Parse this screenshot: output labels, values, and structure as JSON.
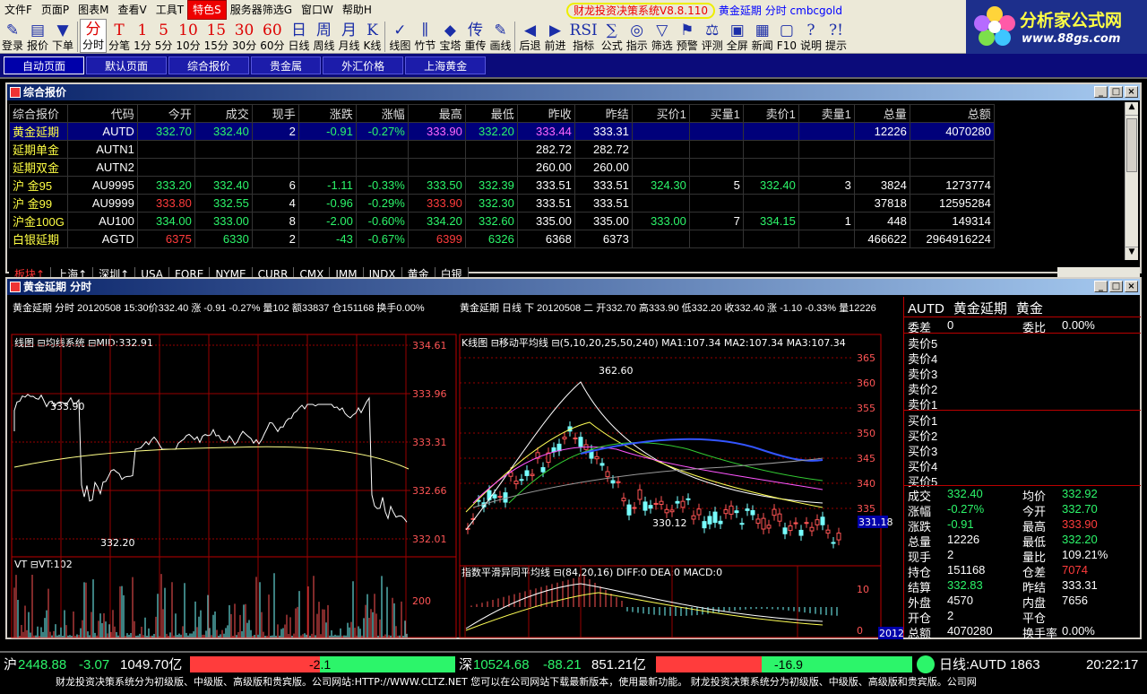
{
  "menu": {
    "items": [
      "文件F",
      "页面P",
      "图表M",
      "查看V",
      "工具T",
      "特色S",
      "服务器筛选G",
      "窗口W",
      "帮助H"
    ]
  },
  "app_title": {
    "name": "财龙投资决策系统V8.8.110",
    "symbol": "黄金延期",
    "view": "分时",
    "user": "cmbcgold"
  },
  "logo": {
    "cn": "分析家公式网",
    "url": "www.88gs.com"
  },
  "toolbar": [
    {
      "icon": "✎",
      "label": "登录"
    },
    {
      "icon": "▤",
      "label": "报价"
    },
    {
      "icon": "▼",
      "label": "下单"
    },
    {
      "icon": "分",
      "label": "分时"
    },
    {
      "icon": "T",
      "label": "分笔"
    },
    {
      "icon": "1",
      "label": "1分"
    },
    {
      "icon": "5",
      "label": "5分"
    },
    {
      "icon": "10",
      "label": "10分"
    },
    {
      "icon": "15",
      "label": "15分"
    },
    {
      "icon": "30",
      "label": "30分"
    },
    {
      "icon": "60",
      "label": "60分"
    },
    {
      "icon": "日",
      "label": "日线"
    },
    {
      "icon": "周",
      "label": "周线"
    },
    {
      "icon": "月",
      "label": "月线"
    },
    {
      "icon": "K",
      "label": "K线"
    },
    {
      "icon": "✓",
      "label": "线图"
    },
    {
      "icon": "∥",
      "label": "竹节"
    },
    {
      "icon": "◆",
      "label": "宝塔"
    },
    {
      "icon": "传",
      "label": "重传"
    },
    {
      "icon": "✎",
      "label": "画线"
    },
    {
      "icon": "◀",
      "label": "后退"
    },
    {
      "icon": "▶",
      "label": "前进"
    },
    {
      "icon": "RSI",
      "label": "指标"
    },
    {
      "icon": "∑",
      "label": "公式"
    },
    {
      "icon": "◎",
      "label": "指示"
    },
    {
      "icon": "▽",
      "label": "筛选"
    },
    {
      "icon": "⚑",
      "label": "预警"
    },
    {
      "icon": "⚖",
      "label": "评测"
    },
    {
      "icon": "▣",
      "label": "全屏"
    },
    {
      "icon": "▦",
      "label": "新闻"
    },
    {
      "icon": "▢",
      "label": "F10"
    },
    {
      "icon": "?",
      "label": "说明"
    },
    {
      "icon": "?!",
      "label": "提示"
    }
  ],
  "nav_tabs": [
    "自动页面",
    "默认页面",
    "综合报价",
    "贵金属",
    "外汇价格",
    "上海黄金"
  ],
  "quote_window": {
    "title": "综合报价",
    "columns": [
      "综合报价",
      "代码",
      "今开",
      "成交",
      "现手",
      "涨跌",
      "涨幅",
      "最高",
      "最低",
      "昨收",
      "昨结",
      "买价1",
      "买量1",
      "卖价1",
      "卖量1",
      "总量",
      "总额"
    ],
    "rows": [
      [
        "黄金延期",
        "AUTD",
        "332.70",
        "332.40",
        "2",
        "-0.91",
        "-0.27%",
        "333.90",
        "332.20",
        "333.44",
        "333.31",
        "",
        "",
        "",
        "",
        "12226",
        "4070280"
      ],
      [
        "延期单金",
        "AUTN1",
        "",
        "",
        "",
        "",
        "",
        "",
        "",
        "282.72",
        "282.72",
        "",
        "",
        "",
        "",
        "",
        ""
      ],
      [
        "延期双金",
        "AUTN2",
        "",
        "",
        "",
        "",
        "",
        "",
        "",
        "260.00",
        "260.00",
        "",
        "",
        "",
        "",
        "",
        ""
      ],
      [
        "沪 金95",
        "AU9995",
        "333.20",
        "332.40",
        "6",
        "-1.11",
        "-0.33%",
        "333.50",
        "332.39",
        "333.51",
        "333.51",
        "324.30",
        "5",
        "332.40",
        "3",
        "3824",
        "1273774"
      ],
      [
        "沪 金99",
        "AU9999",
        "333.80",
        "332.55",
        "4",
        "-0.96",
        "-0.29%",
        "333.90",
        "332.30",
        "333.51",
        "333.51",
        "",
        "",
        "",
        "",
        "37818",
        "12595284"
      ],
      [
        "沪金100G",
        "AU100",
        "334.00",
        "333.00",
        "8",
        "-2.00",
        "-0.60%",
        "334.20",
        "332.60",
        "335.00",
        "335.00",
        "333.00",
        "7",
        "334.15",
        "1",
        "448",
        "149314"
      ],
      [
        "白银延期",
        "AGTD",
        "6375",
        "6330",
        "2",
        "-43",
        "-0.67%",
        "6399",
        "6326",
        "6368",
        "6373",
        "",
        "",
        "",
        "",
        "466622",
        "2964916224"
      ]
    ],
    "sheet_tabs": [
      "板块↑",
      "上海↑",
      "深圳↑",
      "USA",
      "FORE",
      "NYME",
      "CURR",
      "CMX",
      "IMM",
      "INDX",
      "黄金",
      "白银"
    ]
  },
  "chart_window": {
    "title": "黄金延期 分时",
    "intraday": {
      "header": "黄金延期 分时  20120508 15:30价332.40 涨 -0.91 -0.27% 量102 额33837 仓151168 换手0.00%",
      "indicator": "线图 ⊟均线系统 ⊟MID:332.91",
      "vol_label": "VT ⊟VT:102",
      "price_ticks": [
        "334.61",
        "333.96",
        "333.31",
        "332.66",
        "332.01"
      ],
      "vol_tick": "200",
      "time_ticks": [
        "22:00",
        "00:00",
        "02:00",
        "10:30",
        "14:30"
      ],
      "hi_label": "333.90",
      "lo_label": "332.20"
    },
    "kline": {
      "header": "黄金延期 日线 下  20120508 二 开332.70 高333.90 低332.20 收332.40 涨 -1.10 -0.33% 量12226",
      "indicator": "K线图 ⊟移动平均线 ⊟(5,10,20,25,50,240)  MA1:107.34  MA2:107.34  MA3:107.34",
      "macd_label": "指数平滑异同平均线 ⊟(84,20,16) DIFF:0 DEA:0 MACD:0",
      "price_ticks": [
        "365",
        "360",
        "355",
        "350",
        "345",
        "340",
        "335"
      ],
      "macd_ticks": [
        "10",
        "0"
      ],
      "x_ticks": [
        "2012",
        "2",
        "3",
        "4",
        "5"
      ],
      "hi_label": "362.60",
      "lo_label": "330.12",
      "cur_label": "331.18",
      "year_label": "20120"
    },
    "side": {
      "head": [
        "AUTD",
        "黄金延期",
        "黄金"
      ],
      "committee": [
        [
          "委差",
          "0",
          "委比",
          "0.00%"
        ]
      ],
      "asks": [
        "卖价5",
        "卖价4",
        "卖价3",
        "卖价2",
        "卖价1"
      ],
      "bids": [
        "买价1",
        "买价2",
        "买价3",
        "买价4",
        "买价5"
      ],
      "stats": [
        [
          "成交",
          "332.40",
          "均价",
          "332.92"
        ],
        [
          "涨幅",
          "-0.27%",
          "今开",
          "332.70"
        ],
        [
          "涨跌",
          "-0.91",
          "最高",
          "333.90"
        ],
        [
          "总量",
          "12226",
          "最低",
          "332.20"
        ],
        [
          "现手",
          "2",
          "量比",
          "109.21%"
        ],
        [
          "持仓",
          "151168",
          "仓差",
          "7074"
        ],
        [
          "结算",
          "332.83",
          "昨结",
          "333.31"
        ],
        [
          "外盘",
          "4570",
          "内盘",
          "7656"
        ],
        [
          "开仓",
          "2",
          "平仓",
          ""
        ],
        [
          "总额",
          "4070280",
          "换手率",
          "0.00%"
        ]
      ]
    }
  },
  "status": {
    "sh": {
      "label": "沪",
      "value": "2448.88",
      "chg": "-3.07",
      "amt": "1049.70亿",
      "bar": "-2.1"
    },
    "sz": {
      "label": "深",
      "value": "10524.68",
      "chg": "-88.21",
      "amt": "851.21亿",
      "bar": "-16.9"
    },
    "line": "日线:AUTD 1863",
    "time": "20:22:17",
    "ticker": "财龙投资决策系统分为初级版、中级版、高级版和贵宾版。公司网站:HTTP://WWW.CLTZ.NET    您可以在公司网站下载最新版本，使用最新功能。    财龙投资决策系统分为初级版、中级版、高级版和贵宾版。公司网"
  },
  "colors": {
    "up": "#ff3c3c",
    "down": "#2cf56a",
    "grid": "#990000",
    "bg": "#000000",
    "titlebar": "#0a246a"
  }
}
